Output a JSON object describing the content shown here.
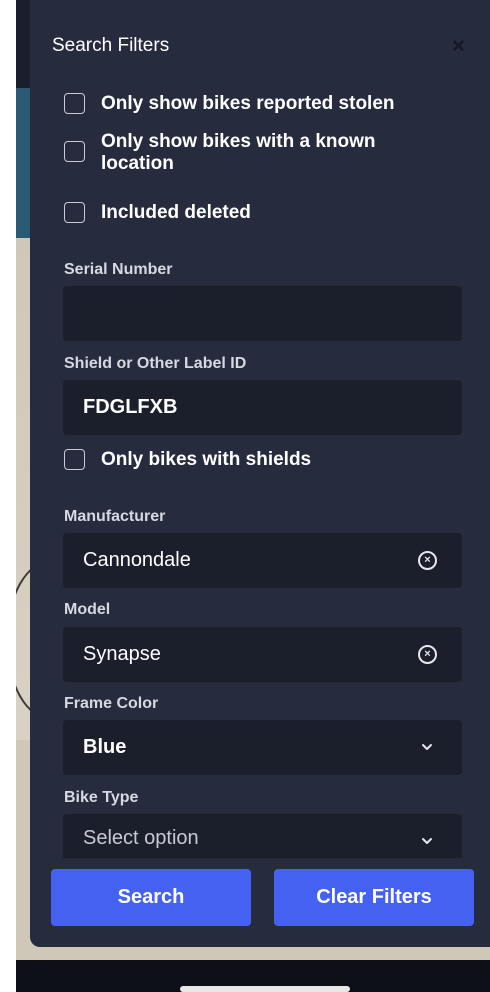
{
  "panel": {
    "title": "Search Filters",
    "close_icon": "×"
  },
  "checkboxes": {
    "stolen": {
      "label": "Only show bikes reported stolen",
      "checked": false
    },
    "location": {
      "label": "Only show bikes with a known location",
      "checked": false
    },
    "deleted": {
      "label": "Included deleted",
      "checked": false
    },
    "shields": {
      "label": "Only bikes with shields",
      "checked": false
    }
  },
  "fields": {
    "serial": {
      "label": "Serial Number",
      "value": ""
    },
    "shield_id": {
      "label": "Shield or Other Label ID",
      "value": "FDGLFXB"
    },
    "manufacturer": {
      "label": "Manufacturer",
      "value": "Cannondale",
      "clear_icon": "×"
    },
    "model": {
      "label": "Model",
      "value": "Synapse",
      "clear_icon": "×"
    },
    "frame_color": {
      "label": "Frame Color",
      "value": "Blue"
    },
    "bike_type": {
      "label": "Bike Type",
      "placeholder": "Select option"
    }
  },
  "buttons": {
    "search": "Search",
    "clear": "Clear Filters"
  },
  "colors": {
    "panel_bg": "#262b3d",
    "input_bg": "#1b1f2c",
    "accent": "#4461f2"
  }
}
